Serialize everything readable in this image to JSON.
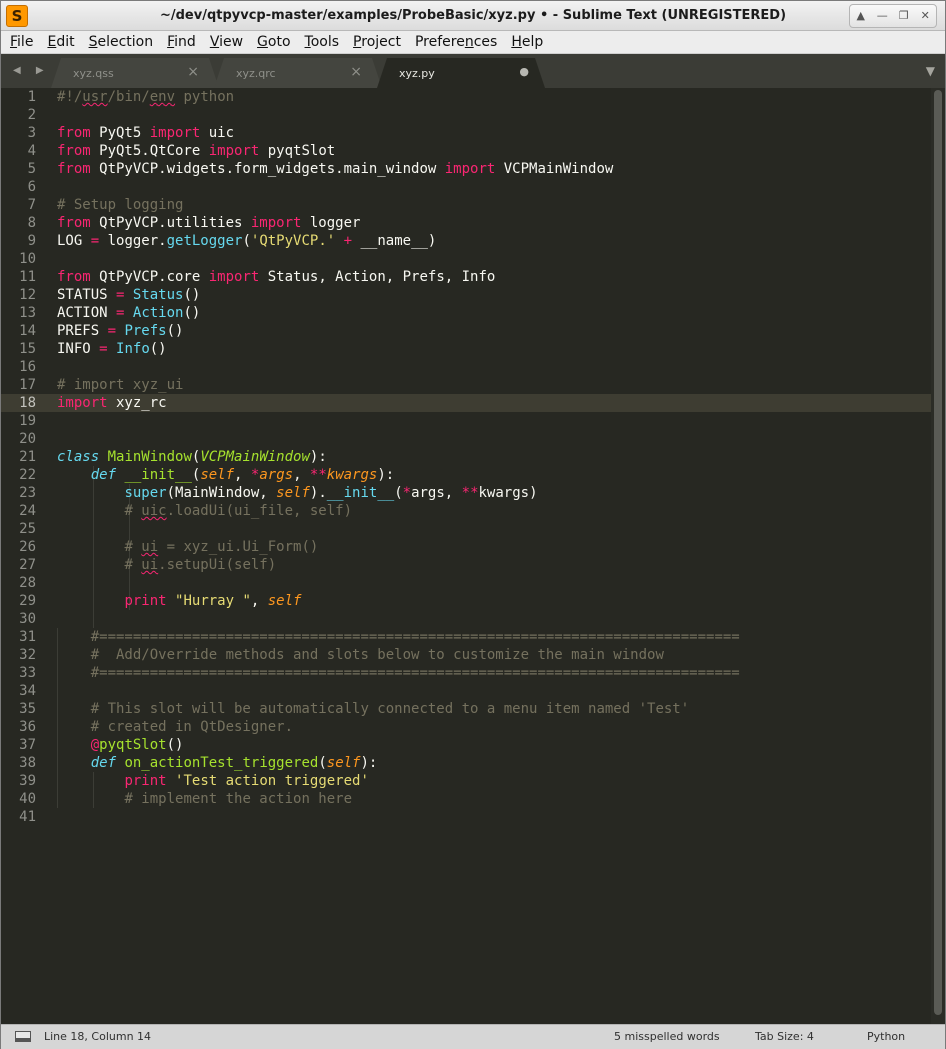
{
  "window": {
    "title": "~/dev/qtpyvcp-master/examples/ProbeBasic/xyz.py • - Sublime Text (UNREGISTERED)",
    "app_icon": "S",
    "controls": [
      "▲",
      "—",
      "❐",
      "✕"
    ]
  },
  "menubar": {
    "items": [
      {
        "u": "F",
        "rest": "ile"
      },
      {
        "u": "E",
        "rest": "dit"
      },
      {
        "u": "S",
        "rest": "election"
      },
      {
        "u": "F",
        "rest": "ind",
        "pre": ""
      },
      {
        "u": "V",
        "rest": "iew"
      },
      {
        "u": "G",
        "rest": "oto"
      },
      {
        "u": "T",
        "rest": "ools"
      },
      {
        "u": "P",
        "rest": "roject"
      },
      {
        "pre": "Prefere",
        "u": "n",
        "rest": "ces"
      },
      {
        "u": "H",
        "rest": "elp"
      }
    ]
  },
  "tabs": [
    {
      "label": "xyz.qss",
      "close": "×"
    },
    {
      "label": "xyz.qrc",
      "close": "×"
    },
    {
      "label": "xyz.py",
      "close": "●"
    }
  ],
  "tabbar": {
    "nav": "◀ ▶",
    "menu": "▼"
  },
  "editor": {
    "current_line": 18,
    "lines": [
      {
        "n": "1",
        "html": "<span class='cm'>#!/<span class='sp'>usr</span>/bin/<span class='sp'>env</span> python</span>"
      },
      {
        "n": "2",
        "html": ""
      },
      {
        "n": "3",
        "html": "<span class='kw'>from</span> PyQt5 <span class='kw'>import</span> uic"
      },
      {
        "n": "4",
        "html": "<span class='kw'>from</span> PyQt5.QtCore <span class='kw'>import</span> pyqtSlot"
      },
      {
        "n": "5",
        "html": "<span class='kw'>from</span> QtPyVCP.widgets.form_widgets.main_window <span class='kw'>import</span> VCPMainWindow"
      },
      {
        "n": "6",
        "html": ""
      },
      {
        "n": "7",
        "html": "<span class='cm'># Setup logging</span>"
      },
      {
        "n": "8",
        "html": "<span class='kw'>from</span> QtPyVCP.utilities <span class='kw'>import</span> logger"
      },
      {
        "n": "9",
        "html": "LOG <span class='kw'>=</span> logger.<span class='bi'>getLogger</span>(<span class='st'>'QtPyVCP.'</span> <span class='kw'>+</span> __name__)"
      },
      {
        "n": "10",
        "html": ""
      },
      {
        "n": "11",
        "html": "<span class='kw'>from</span> QtPyVCP.core <span class='kw'>import</span> Status, Action, Prefs, Info"
      },
      {
        "n": "12",
        "html": "STATUS <span class='kw'>=</span> <span class='bi'>Status</span>()"
      },
      {
        "n": "13",
        "html": "ACTION <span class='kw'>=</span> <span class='bi'>Action</span>()"
      },
      {
        "n": "14",
        "html": "PREFS <span class='kw'>=</span> <span class='bi'>Prefs</span>()"
      },
      {
        "n": "15",
        "html": "INFO <span class='kw'>=</span> <span class='bi'>Info</span>()"
      },
      {
        "n": "16",
        "html": ""
      },
      {
        "n": "17",
        "html": "<span class='cm'># import xyz_ui</span>"
      },
      {
        "n": "18",
        "html": "<span class='kw'>import</span> xyz_rc"
      },
      {
        "n": "19",
        "html": ""
      },
      {
        "n": "20",
        "html": ""
      },
      {
        "n": "21",
        "html": "<span class='st-kw'>class</span> <span class='fn'>MainWindow</span>(<span class='inh'>VCPMainWindow</span>):"
      },
      {
        "n": "22",
        "html": "    <span class='st-kw'>def</span> <span class='fn'>__init__</span>(<span class='par'>self</span>, <span class='kw'>*</span><span class='par'>args</span>, <span class='kw'>**</span><span class='par'>kwargs</span>):"
      },
      {
        "n": "23",
        "html": "        <span class='bi'>super</span>(MainWindow, <span class='par'>self</span>).<span class='bi'>__init__</span>(<span class='kw'>*</span>args, <span class='kw'>**</span>kwargs)"
      },
      {
        "n": "24",
        "html": "        <span class='cm'># <span class='sp'>uic</span>.loadUi(ui_file, self)</span>"
      },
      {
        "n": "25",
        "html": ""
      },
      {
        "n": "26",
        "html": "        <span class='cm'># <span class='sp'>ui</span> = xyz_ui.Ui_Form()</span>"
      },
      {
        "n": "27",
        "html": "        <span class='cm'># <span class='sp'>ui</span>.setupUi(self)</span>"
      },
      {
        "n": "28",
        "html": ""
      },
      {
        "n": "29",
        "html": "        <span class='kw'>print</span> <span class='st'>\"Hurray \"</span>, <span class='par'>self</span>"
      },
      {
        "n": "30",
        "html": ""
      },
      {
        "n": "31",
        "html": "    <span class='cm'>#============================================================================</span>"
      },
      {
        "n": "32",
        "html": "    <span class='cm'>#  Add/Override methods and slots below to customize the main window</span>"
      },
      {
        "n": "33",
        "html": "    <span class='cm'>#============================================================================</span>"
      },
      {
        "n": "34",
        "html": ""
      },
      {
        "n": "35",
        "html": "    <span class='cm'># This slot will be automatically connected to a menu item named 'Test'</span>"
      },
      {
        "n": "36",
        "html": "    <span class='cm'># created in QtDesigner.</span>"
      },
      {
        "n": "37",
        "html": "    <span class='kw'>@</span><span class='fn'>pyqtSlot</span>()"
      },
      {
        "n": "38",
        "html": "    <span class='st-kw'>def</span> <span class='fn'>on_actionTest_triggered</span>(<span class='par'>self</span>):"
      },
      {
        "n": "39",
        "html": "        <span class='kw'>print</span> <span class='st'>'Test action triggered'</span>"
      },
      {
        "n": "40",
        "html": "        <span class='cm'># implement the action here</span>"
      },
      {
        "n": "41",
        "html": ""
      }
    ]
  },
  "status": {
    "position": "Line 18, Column 14",
    "spelling": "5 misspelled words",
    "tab_size": "Tab Size: 4",
    "syntax": "Python"
  },
  "colors": {
    "background": "#272822",
    "keyword": "#f92672",
    "comment": "#75715e",
    "string": "#e6db74",
    "function": "#a6e22e",
    "builtin": "#66d9ef",
    "parameter": "#fd971f"
  }
}
